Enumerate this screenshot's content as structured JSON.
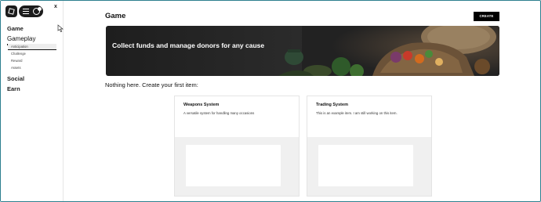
{
  "sidebar": {
    "close_label": "x",
    "sections": {
      "game": "Game",
      "gameplay": "Gameplay",
      "social": "Social",
      "earn": "Earn"
    },
    "gameplay_items": [
      "Anticipation",
      "Challenge",
      "Reward",
      "Assets"
    ]
  },
  "header": {
    "title": "Game",
    "create_label": "CREATE"
  },
  "banner": {
    "text": "Collect funds and manage donors for any cause"
  },
  "main": {
    "empty_message": "Nothing here. Create your first item:",
    "cards": [
      {
        "title": "Weapons System",
        "description": "A versatile system for handling many occasions"
      },
      {
        "title": "Trading System",
        "description": "This is an example item. I am still working on this item."
      }
    ]
  },
  "colors": {
    "accent": "#000000",
    "frame_border": "#2d7f8f",
    "card_bg": "#f0f0f0"
  }
}
